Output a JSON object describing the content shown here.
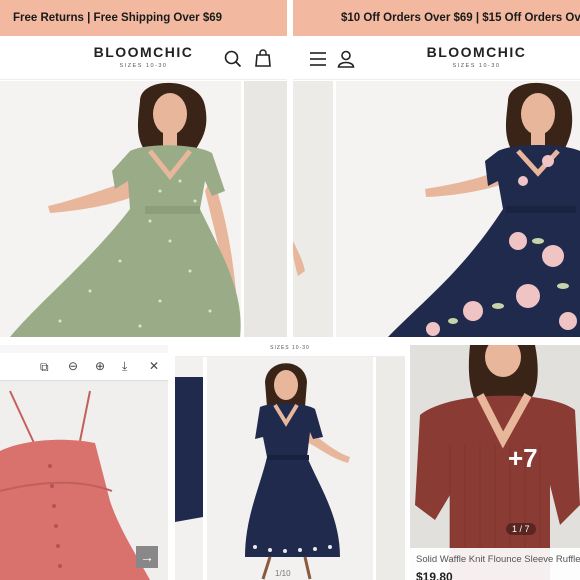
{
  "panel_tl": {
    "promo_text": "Free Returns  |  Free Shipping Over $69",
    "brand": "BLOOMCHIC",
    "brand_sub": "SIZES 10-30"
  },
  "panel_tr": {
    "promo_text": "$10 Off Orders Over $69  |  $15 Off Orders Over $",
    "brand": "BLOOMCHIC",
    "brand_sub": "SIZES 10-30"
  },
  "panel_bm": {
    "brand_sub": "SIZES 10-30",
    "image_counter": "1/10"
  },
  "panel_br": {
    "more_photos": "+7",
    "image_counter": "1 / 7",
    "product_title": "Solid Waffle Knit Flounce Sleeve Ruffle",
    "price": "$19.80"
  },
  "colors": {
    "promo_bar": "#f2b9a0",
    "sage_dress": "#9aac87",
    "navy_dress": "#1f2a4d",
    "coral_dress": "#d9716d",
    "rust_top": "#8a3b33"
  }
}
